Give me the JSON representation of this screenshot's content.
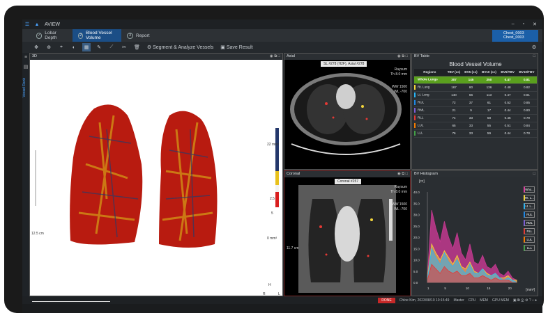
{
  "app": {
    "title": "AVIEW"
  },
  "tabs": [
    {
      "num": "",
      "label": "Lobar Depth"
    },
    {
      "num": "2",
      "label": "Blood Vessel Volume"
    },
    {
      "num": "3",
      "label": "Report"
    }
  ],
  "patient": {
    "line1": "Chest_0003",
    "line2": "Chest_0003"
  },
  "toolbar": {
    "segment_label": "Segment & Analyze Vessels",
    "save_label": "Save Result"
  },
  "sidebar": {
    "vertical_label": "Vessel Rank"
  },
  "panels": {
    "p3d": {
      "title": "3D",
      "scale_top": "22 mm³",
      "scale_mid1": "2.5",
      "scale_mid2": "5",
      "scale_bottom": "0 mm³",
      "ruler": "12.5 cm",
      "orient_h": "H",
      "orient_r": "R",
      "orient_l": "L"
    },
    "axial": {
      "title": "Axial",
      "header": "SL #278 (H2F), Axial #278",
      "raysum": "Raysum",
      "th": "Th 8.0 mm",
      "ww": "WW 1500",
      "wl": "WL -700"
    },
    "coronal": {
      "title": "Coronal",
      "header": "Coronal #257",
      "raysum": "Raysum",
      "th": "Th 8.0 mm",
      "ww": "WW 1500",
      "wl": "WL -700",
      "ruler": "11.7 cm"
    },
    "table_title": "BV Table",
    "hist_title": "BV Histogram"
  },
  "bv_table": {
    "heading": "Blood Vessel Volume",
    "columns": [
      "Regions",
      "TBV (cc)",
      "BV5 (cc)",
      "BV10 (cc)",
      "BV5/TBV",
      "BV10/TBV"
    ],
    "rows": [
      {
        "region": "Whole Lungs",
        "color": "#5aa01e",
        "tbv": "307",
        "bv5": "145",
        "bv10": "250",
        "r5": "0.47",
        "r10": "0.81",
        "whole": true
      },
      {
        "region": "Rt. Lung",
        "color": "#f2d53c",
        "tbv": "167",
        "bv5": "80",
        "bv10": "136",
        "r5": "0.48",
        "r10": "0.82"
      },
      {
        "region": "Lt. Lung",
        "color": "#29b6f6",
        "tbv": "140",
        "bv5": "66",
        "bv10": "113",
        "r5": "0.47",
        "r10": "0.81"
      },
      {
        "region": "RUL",
        "color": "#1e88e5",
        "tbv": "72",
        "bv5": "37",
        "bv10": "61",
        "r5": "0.52",
        "r10": "0.85"
      },
      {
        "region": "RML",
        "color": "#7b5cd6",
        "tbv": "21",
        "bv5": "9",
        "bv10": "17",
        "r5": "0.44",
        "r10": "0.80"
      },
      {
        "region": "RLL",
        "color": "#e53935",
        "tbv": "74",
        "bv5": "33",
        "bv10": "58",
        "r5": "0.45",
        "r10": "0.79"
      },
      {
        "region": "LUL",
        "color": "#f57c00",
        "tbv": "65",
        "bv5": "33",
        "bv10": "55",
        "r5": "0.51",
        "r10": "0.84"
      },
      {
        "region": "LLL",
        "color": "#43a047",
        "tbv": "76",
        "bv5": "33",
        "bv10": "59",
        "r5": "0.44",
        "r10": "0.78"
      }
    ]
  },
  "histogram": {
    "y_unit": "[cc]",
    "x_unit": "[mm²]",
    "y_ticks": [
      "40.0",
      "35.0",
      "30.0",
      "25.0",
      "20.0",
      "15.0",
      "10.0",
      "5.0",
      "0.0"
    ],
    "x_ticks": [
      "1",
      "5",
      "10",
      "15",
      "20"
    ],
    "legend": [
      "Who...",
      "Rt. L...",
      "Lt. L...",
      "RUL",
      "RML",
      "RLL",
      "LUL",
      "LLL"
    ],
    "legend_colors": [
      "#e040a0",
      "#f2d53c",
      "#29b6f6",
      "#1e88e5",
      "#7b5cd6",
      "#e53935",
      "#f57c00",
      "#43a047"
    ]
  },
  "chart_data": {
    "type": "area",
    "x": [
      1,
      2,
      3,
      4,
      5,
      6,
      7,
      8,
      9,
      10,
      11,
      12,
      13,
      14,
      15,
      16,
      17,
      18,
      19,
      20,
      21,
      22
    ],
    "series": [
      {
        "name": "Who...",
        "values": [
          3,
          32,
          24,
          18,
          27,
          20,
          15,
          22,
          13,
          10,
          17,
          9,
          8,
          12,
          7,
          6,
          8,
          4,
          3,
          5,
          2,
          1
        ]
      },
      {
        "name": "Rt. L...",
        "values": [
          2,
          17,
          13,
          10,
          14,
          11,
          8,
          12,
          7,
          6,
          9,
          5,
          4,
          6,
          4,
          3,
          4,
          2,
          2,
          3,
          1,
          1
        ]
      },
      {
        "name": "Lt. L...",
        "values": [
          1,
          15,
          11,
          8,
          13,
          9,
          7,
          10,
          6,
          4,
          8,
          4,
          4,
          6,
          3,
          3,
          4,
          2,
          1,
          2,
          1,
          0
        ]
      },
      {
        "name": "RLL",
        "values": [
          1,
          8,
          6,
          4,
          7,
          5,
          4,
          5,
          3,
          3,
          4,
          2,
          2,
          3,
          2,
          1,
          2,
          1,
          1,
          1,
          0,
          0
        ]
      }
    ],
    "ylim": [
      0,
      40
    ],
    "xlabel": "[mm²]",
    "ylabel": "[cc]"
  },
  "status": {
    "done": "DONE",
    "user": "Chloe Kim, 2023/08/10 10:15:49",
    "master": "Master",
    "cpu": "CPU",
    "mem": "MEM",
    "gpu": "GPU MEM"
  }
}
